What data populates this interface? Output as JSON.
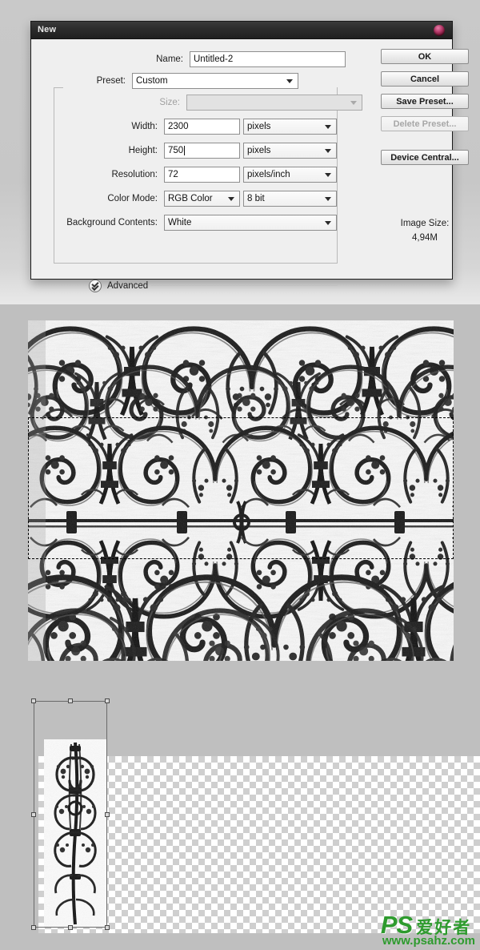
{
  "dialog": {
    "title": "New",
    "close_icon": "close-button-icon",
    "fields": {
      "name": {
        "label": "Name:",
        "value": "Untitled-2",
        "placeholder": "Untitled-1"
      },
      "preset": {
        "label": "Preset:",
        "value": "Custom"
      },
      "size": {
        "label": "Size:",
        "value": "",
        "disabled": true
      },
      "width": {
        "label": "Width:",
        "value": "2300",
        "unit": "pixels"
      },
      "height": {
        "label": "Height:",
        "value": "750",
        "unit": "pixels",
        "focused": true
      },
      "resolution": {
        "label": "Resolution:",
        "value": "72",
        "unit": "pixels/inch"
      },
      "color_mode": {
        "label": "Color Mode:",
        "value": "RGB Color",
        "depth": "8 bit"
      },
      "background_contents": {
        "label": "Background Contents:",
        "value": "White"
      }
    },
    "buttons": [
      {
        "label": "OK",
        "disabled": false
      },
      {
        "label": "Cancel",
        "disabled": false
      },
      {
        "label": "Save Preset...",
        "disabled": false
      },
      {
        "label": "Delete Preset...",
        "disabled": true
      },
      {
        "label": "Device Central...",
        "disabled": false
      }
    ],
    "image_size": {
      "label": "Image Size:",
      "value": "4,94M"
    },
    "advanced": {
      "label": "Advanced",
      "icon": "chevron-double-down-icon",
      "expanded": false
    }
  },
  "canvas_middle": {
    "name": "ornament-texture-canvas",
    "selection": {
      "type": "rectangular-marquee",
      "style": "marching-ants-dashed"
    }
  },
  "canvas_bottom": {
    "name": "transparent-layer-canvas",
    "background": "transparency-checkerboard",
    "transform": {
      "active": true,
      "handles": 8
    }
  },
  "watermark": {
    "brand": "PS",
    "brand_cn": "爱好者",
    "url": "www.psahz.com",
    "color": "#2e9b2e"
  }
}
